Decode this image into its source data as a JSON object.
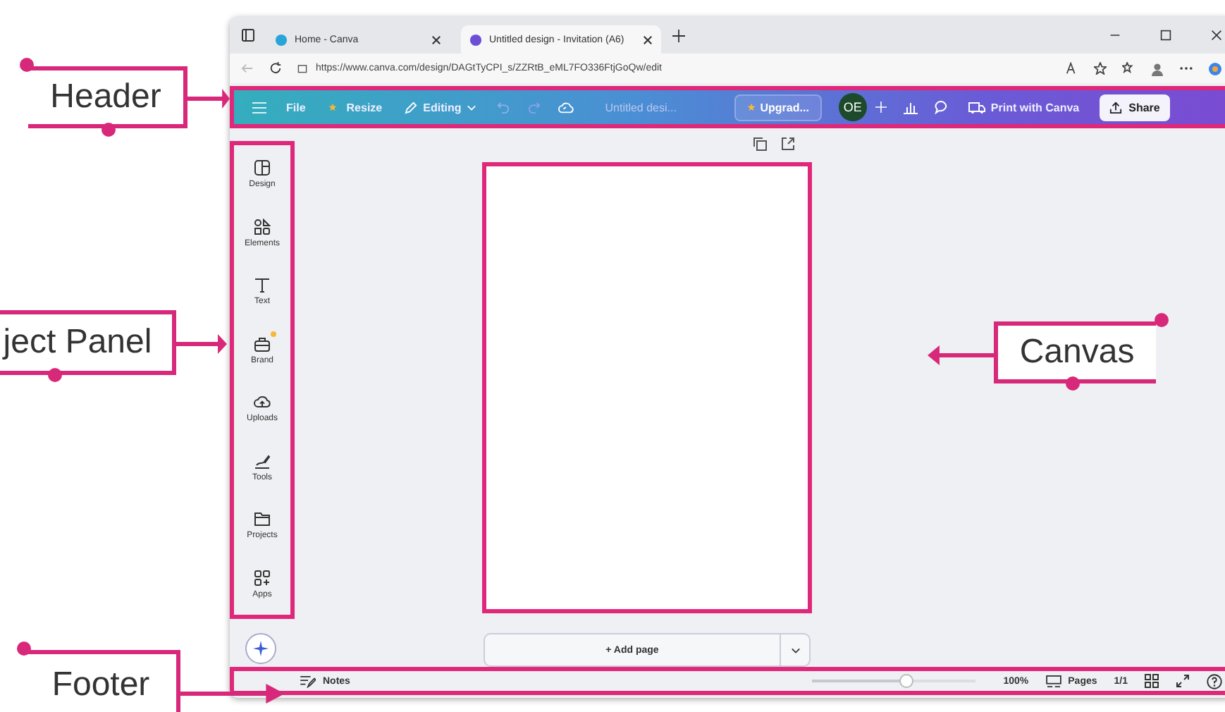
{
  "browser": {
    "tabs": [
      {
        "title": "Home - Canva",
        "selected": false
      },
      {
        "title": "Untitled design - Invitation (A6)",
        "selected": true
      }
    ],
    "url": "https://www.canva.com/design/DAGtTyCPI_s/ZZRtB_eML7FO336FtjGoQw/edit"
  },
  "header": {
    "file": "File",
    "resize": "Resize",
    "editing": "Editing",
    "title": "Untitled desi...",
    "upgrade": "Upgrad...",
    "avatar": "OE",
    "print": "Print with Canva",
    "share": "Share"
  },
  "sidebar": {
    "items": [
      {
        "kind": "design",
        "label": "Design",
        "dot": false
      },
      {
        "kind": "elements",
        "label": "Elements",
        "dot": false
      },
      {
        "kind": "text",
        "label": "Text",
        "dot": false
      },
      {
        "kind": "brand",
        "label": "Brand",
        "dot": true
      },
      {
        "kind": "uploads",
        "label": "Uploads",
        "dot": false
      },
      {
        "kind": "tools",
        "label": "Tools",
        "dot": false
      },
      {
        "kind": "projects",
        "label": "Projects",
        "dot": false
      },
      {
        "kind": "apps",
        "label": "Apps",
        "dot": false
      }
    ]
  },
  "canvas": {
    "add_page": "+ Add page"
  },
  "footer": {
    "notes": "Notes",
    "zoom": {
      "level": 0.58
    },
    "zoom_reading": "100%",
    "pages": "Pages",
    "page_count": "1/1"
  },
  "callouts": [
    {
      "label": "Header",
      "kind": "left"
    },
    {
      "label": "ject Panel",
      "kind": "left"
    },
    {
      "label": "Canvas",
      "kind": "right"
    },
    {
      "label": "Footer",
      "kind": "left"
    }
  ]
}
